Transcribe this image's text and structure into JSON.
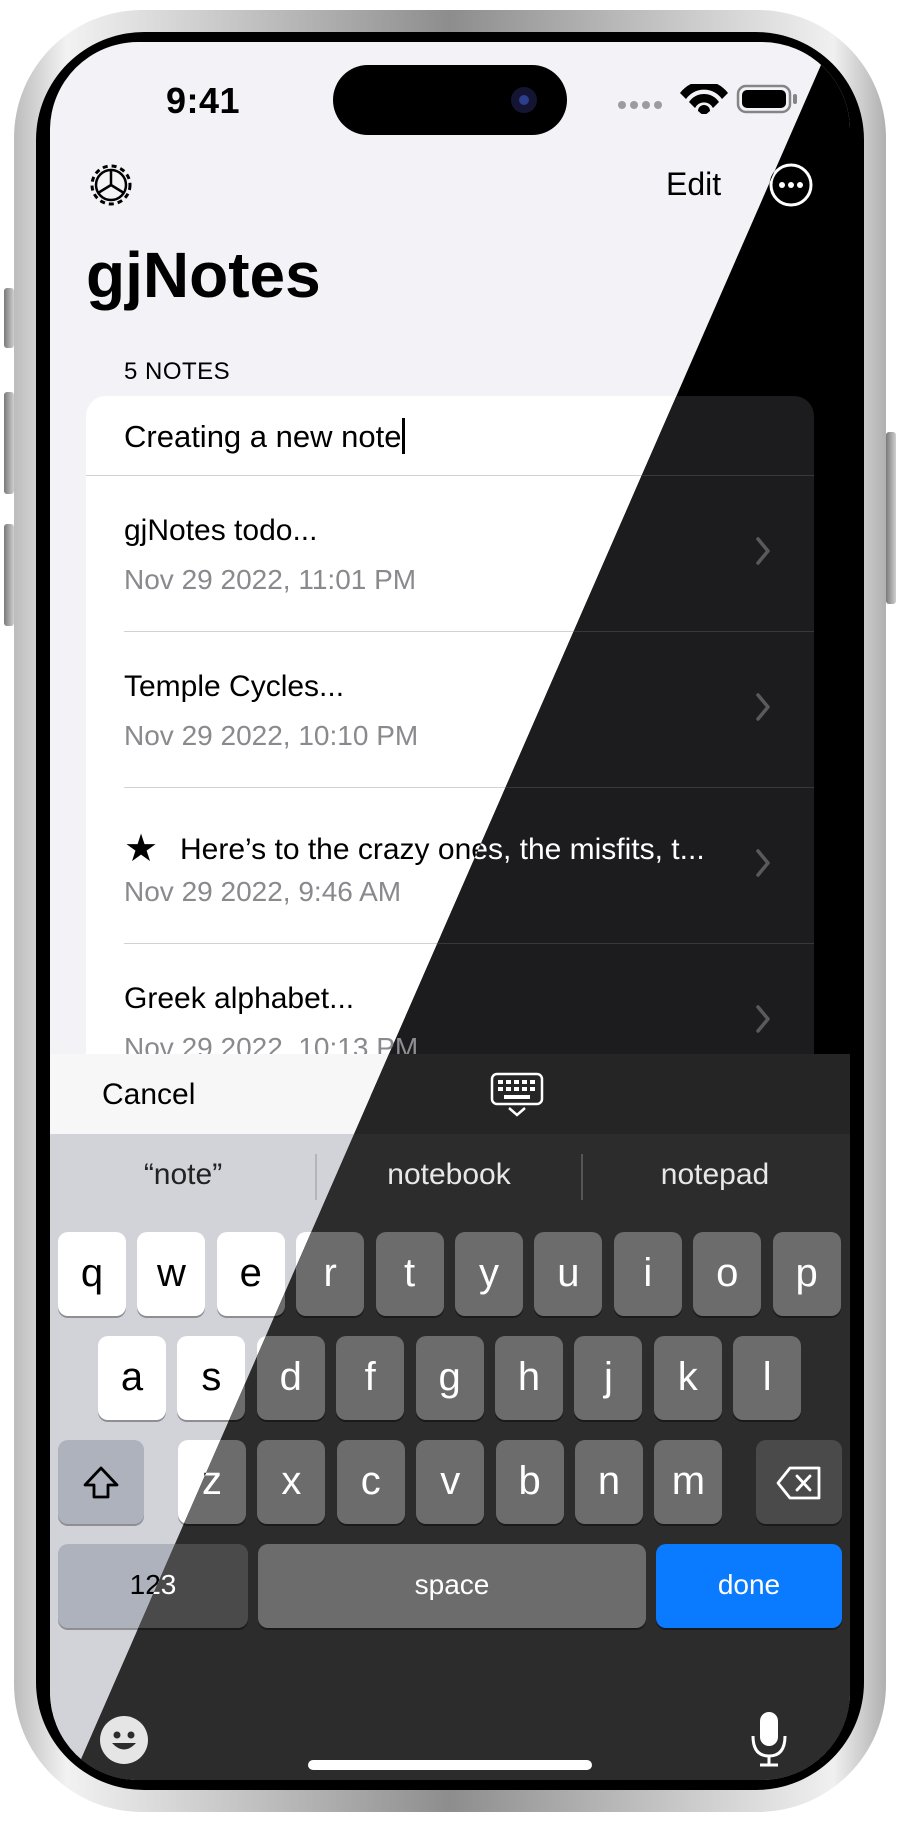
{
  "status_bar": {
    "time": "9:41"
  },
  "nav": {
    "edit_label": "Edit",
    "title": "gjNotes"
  },
  "list": {
    "section_header": "5 NOTES",
    "new_note_text": "Creating a new note",
    "notes": [
      {
        "title": "gjNotes todo...",
        "date": "Nov 29 2022, 11:01 PM",
        "starred": false
      },
      {
        "title": "Temple Cycles...",
        "date": "Nov 29 2022, 10:10 PM",
        "starred": false
      },
      {
        "title": "Here’s to the crazy ones, the misfits, t...",
        "date": "Nov 29 2022, 9:46 AM",
        "starred": true
      },
      {
        "title": "Greek alphabet...",
        "date": "Nov 29 2022, 10:13 PM",
        "starred": false
      }
    ]
  },
  "accessory": {
    "cancel_label": "Cancel"
  },
  "keyboard": {
    "suggestions": [
      "“note”",
      "notebook",
      "notepad"
    ],
    "row1": [
      "q",
      "w",
      "e",
      "r",
      "t",
      "y",
      "u",
      "i",
      "o",
      "p"
    ],
    "row2": [
      "a",
      "s",
      "d",
      "f",
      "g",
      "h",
      "j",
      "k",
      "l"
    ],
    "row3": [
      "z",
      "x",
      "c",
      "v",
      "b",
      "n",
      "m"
    ],
    "numbers_label": "123",
    "space_label": "space",
    "done_label": "done"
  },
  "icons": {
    "settings": "gear-icon",
    "more": "ellipsis-circle-icon",
    "chevron": "chevron-right-icon",
    "star": "star-icon",
    "keyboard_dismiss": "keyboard-dismiss-icon",
    "shift": "shift-icon",
    "delete": "delete-icon",
    "emoji": "emoji-icon",
    "mic": "mic-icon"
  },
  "colors": {
    "accent": "#0a7aff",
    "light_bg": "#f2f2f7",
    "dark_bg": "#000000"
  }
}
